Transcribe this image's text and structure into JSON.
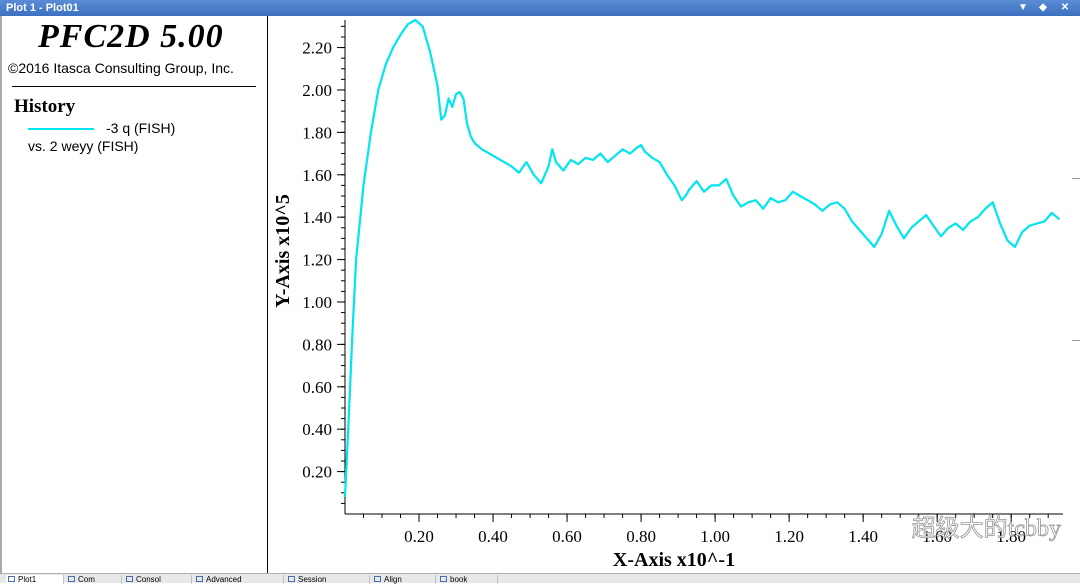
{
  "window": {
    "title": "Plot 1 - Plot01",
    "controls": [
      "▼",
      "◆",
      "✕"
    ]
  },
  "legend": {
    "app_title": "PFC2D 5.00",
    "copyright": "©2016 Itasca Consulting Group, Inc.",
    "section_title": "History",
    "series_label": "-3 q (FISH)",
    "series_vs": "vs. 2 weyy (FISH)",
    "series_color": "#00e5ee"
  },
  "chart_data": {
    "type": "line",
    "xlabel": "X-Axis x10^-1",
    "ylabel": "Y-Axis x10^5",
    "x_ticks": [
      "0.20",
      "0.40",
      "0.60",
      "0.80",
      "1.00",
      "1.20",
      "1.40",
      "1.60",
      "1.80"
    ],
    "y_ticks": [
      "0.20",
      "0.40",
      "0.60",
      "0.80",
      "1.00",
      "1.20",
      "1.40",
      "1.60",
      "1.80",
      "2.00",
      "2.20"
    ],
    "xlim": [
      0.0,
      1.94
    ],
    "ylim": [
      0.0,
      2.33
    ],
    "grid": false,
    "series": [
      {
        "color": "#00e5ee",
        "x": [
          0.0,
          0.01,
          0.02,
          0.03,
          0.05,
          0.07,
          0.09,
          0.11,
          0.13,
          0.15,
          0.17,
          0.19,
          0.21,
          0.23,
          0.25,
          0.26,
          0.27,
          0.28,
          0.29,
          0.3,
          0.31,
          0.32,
          0.33,
          0.34,
          0.35,
          0.37,
          0.39,
          0.41,
          0.43,
          0.45,
          0.47,
          0.49,
          0.51,
          0.53,
          0.55,
          0.56,
          0.57,
          0.59,
          0.61,
          0.63,
          0.65,
          0.67,
          0.69,
          0.71,
          0.73,
          0.75,
          0.77,
          0.79,
          0.8,
          0.81,
          0.83,
          0.85,
          0.87,
          0.89,
          0.91,
          0.92,
          0.93,
          0.95,
          0.97,
          0.99,
          1.01,
          1.03,
          1.05,
          1.07,
          1.09,
          1.11,
          1.13,
          1.15,
          1.17,
          1.19,
          1.21,
          1.23,
          1.25,
          1.27,
          1.29,
          1.31,
          1.33,
          1.35,
          1.37,
          1.39,
          1.41,
          1.43,
          1.45,
          1.47,
          1.49,
          1.51,
          1.53,
          1.55,
          1.57,
          1.59,
          1.61,
          1.63,
          1.65,
          1.67,
          1.69,
          1.71,
          1.73,
          1.75,
          1.77,
          1.79,
          1.81,
          1.83,
          1.85,
          1.87,
          1.89,
          1.91,
          1.93
        ],
        "y": [
          0.08,
          0.45,
          0.85,
          1.2,
          1.55,
          1.8,
          2.0,
          2.12,
          2.2,
          2.26,
          2.31,
          2.33,
          2.3,
          2.18,
          2.02,
          1.86,
          1.88,
          1.96,
          1.92,
          1.98,
          1.99,
          1.96,
          1.84,
          1.78,
          1.75,
          1.72,
          1.7,
          1.68,
          1.66,
          1.64,
          1.61,
          1.66,
          1.6,
          1.56,
          1.64,
          1.72,
          1.66,
          1.62,
          1.67,
          1.65,
          1.68,
          1.67,
          1.7,
          1.66,
          1.69,
          1.72,
          1.7,
          1.73,
          1.74,
          1.71,
          1.68,
          1.66,
          1.6,
          1.55,
          1.48,
          1.5,
          1.53,
          1.57,
          1.52,
          1.55,
          1.55,
          1.58,
          1.5,
          1.45,
          1.47,
          1.48,
          1.44,
          1.49,
          1.47,
          1.48,
          1.52,
          1.5,
          1.48,
          1.46,
          1.43,
          1.46,
          1.47,
          1.44,
          1.38,
          1.34,
          1.3,
          1.26,
          1.32,
          1.43,
          1.36,
          1.3,
          1.35,
          1.38,
          1.41,
          1.36,
          1.31,
          1.35,
          1.37,
          1.34,
          1.38,
          1.4,
          1.44,
          1.47,
          1.37,
          1.29,
          1.26,
          1.33,
          1.36,
          1.37,
          1.38,
          1.42,
          1.39
        ]
      }
    ]
  },
  "tabs": [
    {
      "label": "Plot1"
    },
    {
      "label": "Com"
    },
    {
      "label": "Consol"
    },
    {
      "label": "Advanced"
    },
    {
      "label": "Session"
    },
    {
      "label": "Align"
    },
    {
      "label": "book"
    }
  ],
  "watermark": {
    "text": "超级大的tcbby"
  }
}
